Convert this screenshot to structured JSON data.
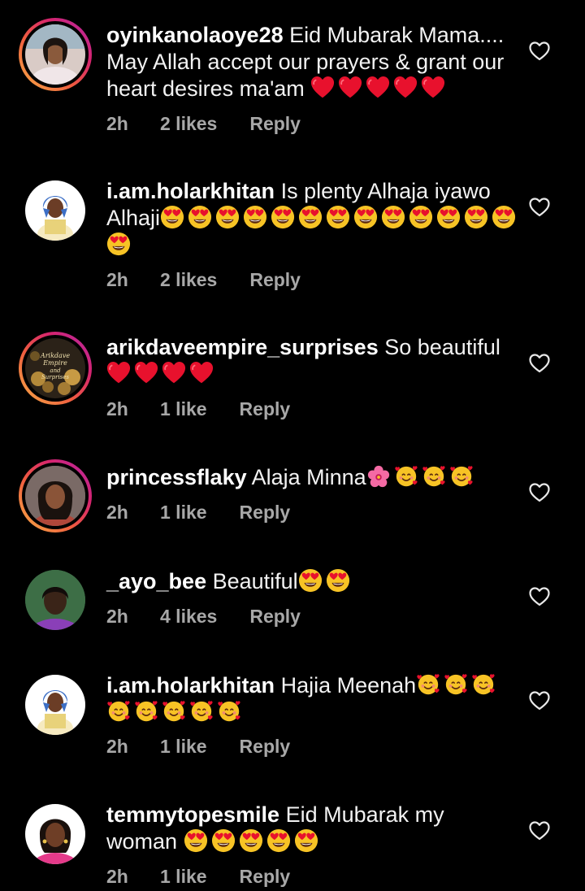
{
  "comments": [
    {
      "username": "oyinkanolaoye28",
      "text": "Eid Mubarak Mama.... May Allah accept our prayers & grant our heart desires ma'am",
      "emojis": [
        "heart",
        "heart",
        "heart",
        "heart",
        "heart"
      ],
      "time": "2h",
      "likes": "2 likes",
      "reply": "Reply",
      "story_ring": true
    },
    {
      "username": "i.am.holarkhitan",
      "text": "Is plenty Alhaja iyawo Alhaji",
      "emojis": [
        "heart-eyes",
        "heart-eyes",
        "heart-eyes",
        "heart-eyes",
        "heart-eyes",
        "heart-eyes",
        "heart-eyes",
        "heart-eyes",
        "heart-eyes",
        "heart-eyes",
        "heart-eyes",
        "heart-eyes",
        "heart-eyes",
        "heart-eyes"
      ],
      "time": "2h",
      "likes": "2 likes",
      "reply": "Reply",
      "story_ring": false
    },
    {
      "username": "arikdaveempire_surprises",
      "text": "So beautiful",
      "emojis": [
        "heart",
        "heart",
        "heart",
        "heart"
      ],
      "time": "2h",
      "likes": "1 like",
      "reply": "Reply",
      "story_ring": true,
      "avatar_text": "Arikdave Empire and Surprises"
    },
    {
      "username": "princessflaky",
      "text": "Alaja Minna",
      "emojis": [
        "blossom",
        "smiling-hearts",
        "smiling-hearts",
        "smiling-hearts"
      ],
      "time": "2h",
      "likes": "1 like",
      "reply": "Reply",
      "story_ring": true
    },
    {
      "username": "_ayo_bee",
      "text": "Beautiful",
      "emojis": [
        "heart-eyes",
        "heart-eyes"
      ],
      "time": "2h",
      "likes": "4 likes",
      "reply": "Reply",
      "story_ring": false
    },
    {
      "username": "i.am.holarkhitan",
      "text": "Hajia Meenah",
      "emojis": [
        "smiling-hearts",
        "smiling-hearts",
        "smiling-hearts",
        "smiling-hearts",
        "smiling-hearts",
        "smiling-hearts",
        "smiling-hearts",
        "smiling-hearts"
      ],
      "time": "2h",
      "likes": "1 like",
      "reply": "Reply",
      "story_ring": false
    },
    {
      "username": "temmytopesmile",
      "text": "Eid Mubarak my woman",
      "emojis": [
        "heart-eyes",
        "heart-eyes",
        "heart-eyes",
        "heart-eyes",
        "heart-eyes"
      ],
      "time": "2h",
      "likes": "1 like",
      "reply": "Reply",
      "story_ring": false
    }
  ],
  "icons": {
    "like": "heart-outline-icon"
  },
  "colors": {
    "background": "#000000",
    "meta_text": "#a8a8a8",
    "ring_start": "#f7b046",
    "ring_end": "#b22aa8",
    "heart_emoji": "#e8112d"
  }
}
